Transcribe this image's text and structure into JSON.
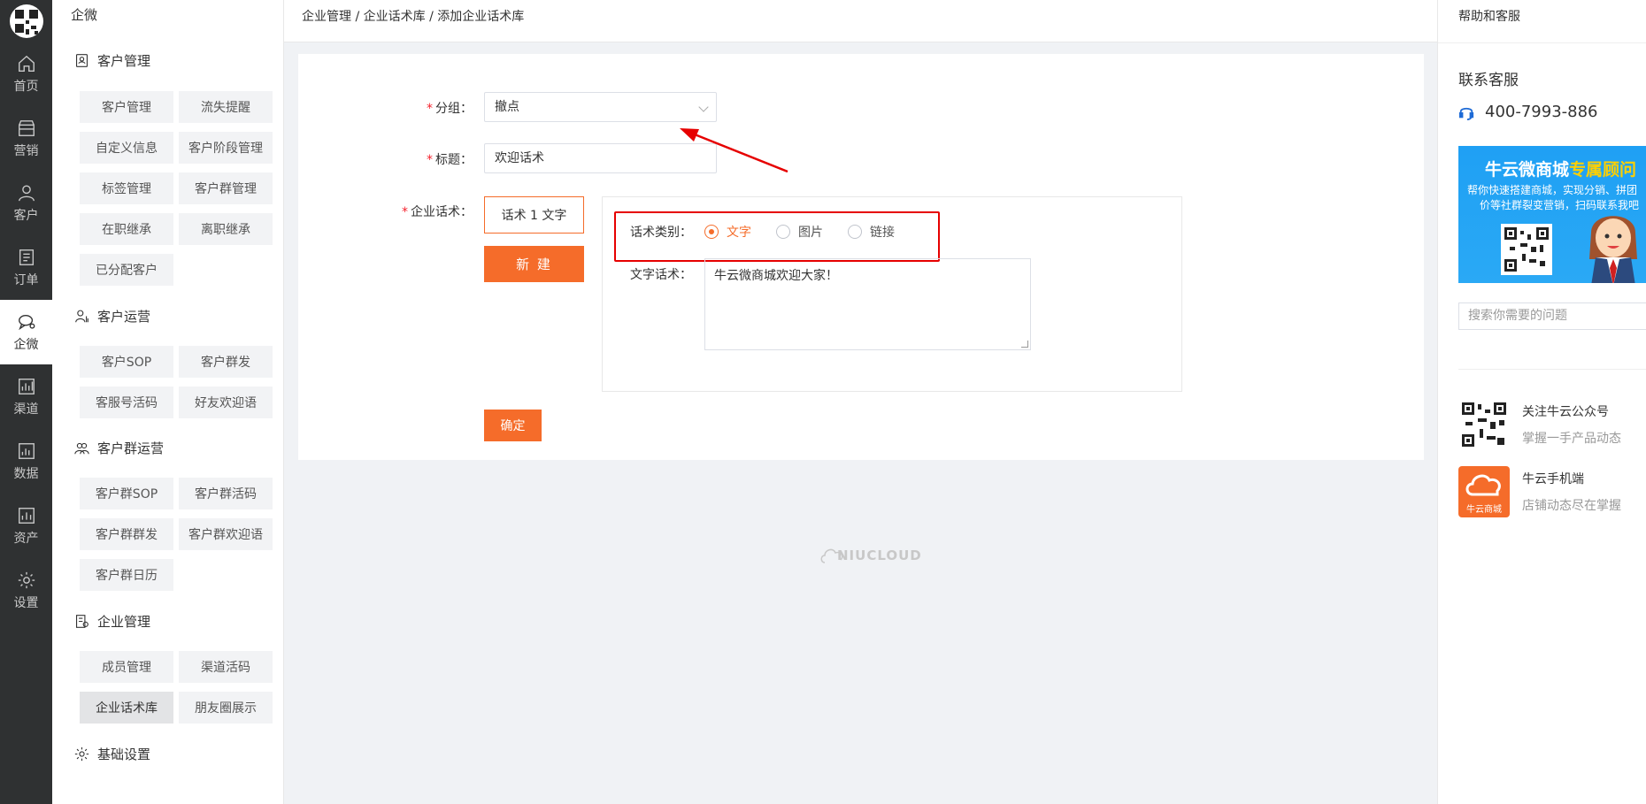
{
  "nav": {
    "items": [
      {
        "label": "首页",
        "icon": "home-icon"
      },
      {
        "label": "营销",
        "icon": "shop-icon"
      },
      {
        "label": "客户",
        "icon": "user-icon"
      },
      {
        "label": "订单",
        "icon": "order-icon"
      },
      {
        "label": "企微",
        "icon": "chat-icon",
        "active": true
      },
      {
        "label": "渠道",
        "icon": "channel-icon"
      },
      {
        "label": "数据",
        "icon": "data-icon"
      },
      {
        "label": "资产",
        "icon": "asset-icon"
      },
      {
        "label": "设置",
        "icon": "gear-icon"
      }
    ]
  },
  "subside": {
    "title": "企微",
    "sections": [
      {
        "title": "客户管理",
        "items": [
          "客户管理",
          "流失提醒",
          "自定义信息",
          "客户阶段管理",
          "标签管理",
          "客户群管理",
          "在职继承",
          "离职继承",
          "已分配客户"
        ]
      },
      {
        "title": "客户运营",
        "items": [
          "客户SOP",
          "客户群发",
          "客服号活码",
          "好友欢迎语"
        ]
      },
      {
        "title": "客户群运营",
        "items": [
          "客户群SOP",
          "客户群活码",
          "客户群群发",
          "客户群欢迎语",
          "客户群日历"
        ]
      },
      {
        "title": "企业管理",
        "items": [
          "成员管理",
          "渠道活码",
          "企业话术库",
          "朋友圈展示"
        ]
      },
      {
        "title": "基础设置",
        "items": []
      }
    ]
  },
  "breadcrumb": "企业管理 / 企业话术库 / 添加企业话术库",
  "form": {
    "group_label": "分组：",
    "group_value": "撤点",
    "title_label": "标题：",
    "title_value": "欢迎话术",
    "script_label": "企业话术：",
    "tab_label": "话术 1 文字",
    "new_button": "新 建",
    "type_label": "话术类别：",
    "types": [
      "文字",
      "图片",
      "链接"
    ],
    "selected_type": "文字",
    "text_label": "文字话术：",
    "text_value": "牛云微商城欢迎大家！",
    "confirm_button": "确定"
  },
  "watermark": "NIUCLOUD",
  "right": {
    "title": "帮助和客服",
    "contact_title": "联系客服",
    "phone": "400-7993-886",
    "banner_title_main": "牛云微商城",
    "banner_title_accent": "专属顾问",
    "banner_sub1": "帮你快速搭建商城，实现分销、拼团",
    "banner_sub2": "价等社群裂变营销，扫码联系我吧",
    "search_placeholder": "搜索你需要的问题",
    "follow1_title": "关注牛云公众号",
    "follow1_sub": "掌握一手产品动态",
    "follow2_title": "牛云手机端",
    "follow2_sub": "店铺动态尽在掌握",
    "app_icon_text": "牛云商城"
  },
  "colors": {
    "accent": "#f56c2a",
    "highlight_box": "#e60000",
    "nav_bg": "#2f3132"
  }
}
